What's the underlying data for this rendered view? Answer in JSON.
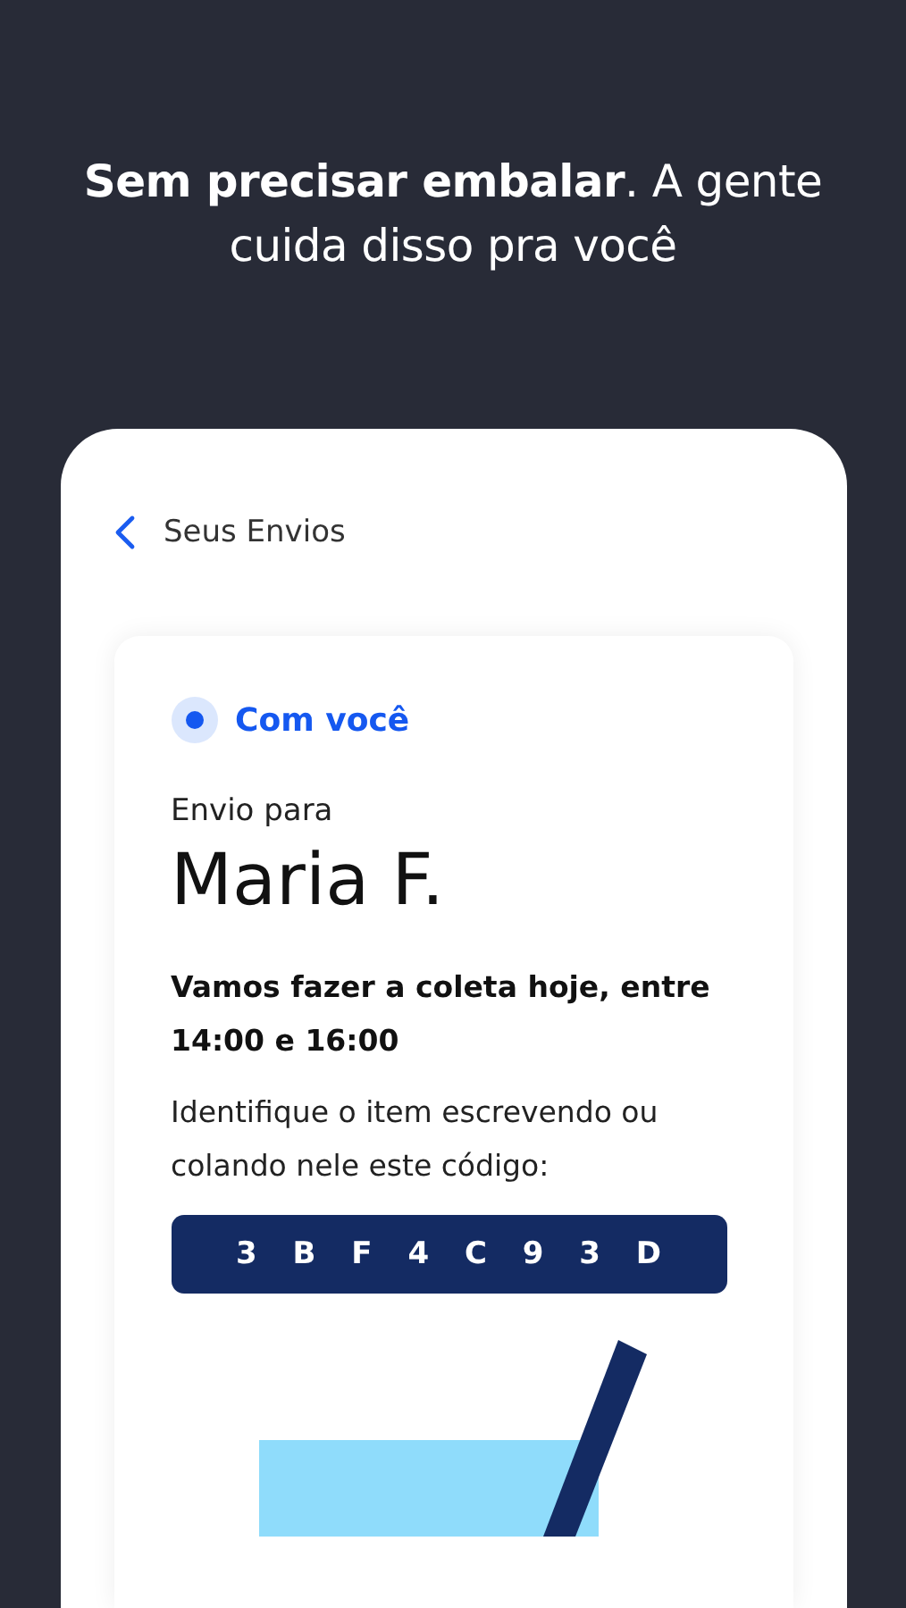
{
  "headline": "**Sem precisar embalar**. A gente cuida disso pra você",
  "screen": {
    "back_label": "Seus Envios",
    "shipment": {
      "status": "Com você",
      "recipient_label": "Envio para",
      "recipient": "Maria F.",
      "pickup": "Vamos fazer a coleta hoje, entre 14:00 e 16:00",
      "instruction": "Identifique o item escrevendo ou colando nele este código:",
      "code": "3 B F 4 C 9 3 D"
    }
  }
}
